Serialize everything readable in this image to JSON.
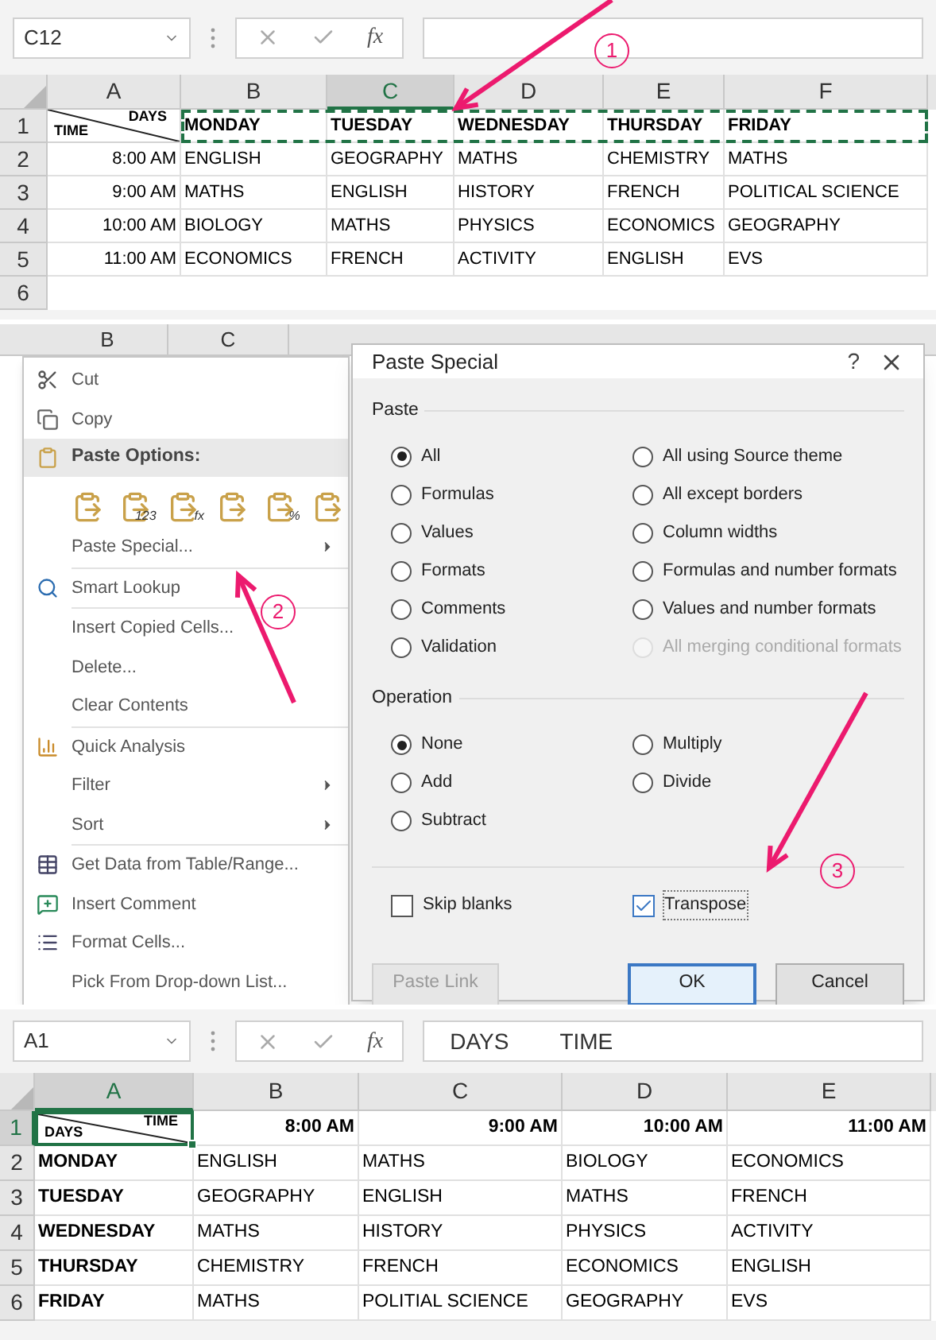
{
  "step1": {
    "name_box": "C12",
    "function_label": "fx",
    "callout": "1",
    "columns": [
      {
        "label": "A",
        "selected": false
      },
      {
        "label": "B",
        "selected": false
      },
      {
        "label": "C",
        "selected": true
      },
      {
        "label": "D",
        "selected": false
      },
      {
        "label": "E",
        "selected": false
      },
      {
        "label": "F",
        "selected": false
      }
    ],
    "rows": [
      {
        "number": "1",
        "selected": false,
        "marquee": true,
        "corner": {
          "top": "DAYS",
          "bottom": "TIME",
          "selected": false
        },
        "cells": [
          "MONDAY",
          "TUESDAY",
          "WEDNESDAY",
          "THURSDAY",
          "FRIDAY"
        ]
      },
      {
        "number": "2",
        "selected": false,
        "cells": [
          "8:00 AM",
          "ENGLISH",
          "GEOGRAPHY",
          "MATHS",
          "CHEMISTRY",
          "MATHS"
        ]
      },
      {
        "number": "3",
        "selected": false,
        "cells": [
          "9:00 AM",
          "MATHS",
          "ENGLISH",
          "HISTORY",
          "FRENCH",
          "POLITICAL SCIENCE"
        ]
      },
      {
        "number": "4",
        "selected": false,
        "cells": [
          "10:00 AM",
          "BIOLOGY",
          "MATHS",
          "PHYSICS",
          "ECONOMICS",
          "GEOGRAPHY"
        ]
      },
      {
        "number": "5",
        "selected": false,
        "cells": [
          "11:00 AM",
          "ECONOMICS",
          "FRENCH",
          "ACTIVITY",
          "ENGLISH",
          "EVS"
        ]
      },
      {
        "number": "6",
        "selected": false
      }
    ]
  },
  "step2": {
    "background_columns": [
      "B",
      "C"
    ],
    "menu": {
      "items": [
        {
          "kind": "item",
          "label": "Cut"
        },
        {
          "kind": "item",
          "label": "Copy"
        },
        {
          "kind": "header",
          "label": "Paste Options:"
        },
        {
          "kind": "paste_icons",
          "icons": [
            {
              "kind": "plain"
            },
            {
              "kind": "labeled",
              "label": "123"
            },
            {
              "kind": "labeled",
              "label": "fx"
            },
            {
              "kind": "plain"
            },
            {
              "kind": "labeled",
              "label": "%"
            },
            {
              "kind": "plain"
            }
          ]
        },
        {
          "kind": "submenu",
          "label": "Paste Special..."
        },
        {
          "kind": "separator"
        },
        {
          "kind": "item",
          "label": "Smart Lookup"
        },
        {
          "kind": "separator"
        },
        {
          "kind": "item",
          "label": "Insert Copied Cells..."
        },
        {
          "kind": "item",
          "label": "Delete..."
        },
        {
          "kind": "item",
          "label": "Clear Contents"
        },
        {
          "kind": "separator"
        },
        {
          "kind": "item",
          "label": "Quick Analysis"
        },
        {
          "kind": "submenu",
          "label": "Filter"
        },
        {
          "kind": "submenu",
          "label": "Sort"
        },
        {
          "kind": "separator"
        },
        {
          "kind": "item",
          "label": "Get Data from Table/Range..."
        },
        {
          "kind": "item",
          "label": "Insert Comment"
        },
        {
          "kind": "item",
          "label": "Format Cells..."
        },
        {
          "kind": "item",
          "label": "Pick From Drop-down List..."
        }
      ]
    },
    "dialog": {
      "title": "Paste Special",
      "help": "?",
      "paste_label": "Paste",
      "paste_left": [
        {
          "label": "All",
          "selected": true,
          "disabled": false
        },
        {
          "label": "Formulas",
          "selected": false,
          "disabled": false
        },
        {
          "label": "Values",
          "selected": false,
          "disabled": false
        },
        {
          "label": "Formats",
          "selected": false,
          "disabled": false
        },
        {
          "label": "Comments",
          "selected": false,
          "disabled": false
        },
        {
          "label": "Validation",
          "selected": false,
          "disabled": false
        }
      ],
      "paste_right": [
        {
          "label": "All using Source theme",
          "selected": false,
          "disabled": false
        },
        {
          "label": "All except borders",
          "selected": false,
          "disabled": false
        },
        {
          "label": "Column widths",
          "selected": false,
          "disabled": false
        },
        {
          "label": "Formulas and number formats",
          "selected": false,
          "disabled": false
        },
        {
          "label": "Values and number formats",
          "selected": false,
          "disabled": false
        },
        {
          "label": "All merging conditional formats",
          "selected": false,
          "disabled": true
        }
      ],
      "operation_label": "Operation",
      "operation_left": [
        {
          "label": "None",
          "selected": true,
          "disabled": false
        },
        {
          "label": "Add",
          "selected": false,
          "disabled": false
        },
        {
          "label": "Subtract",
          "selected": false,
          "disabled": false
        }
      ],
      "operation_right": [
        {
          "label": "Multiply",
          "selected": false,
          "disabled": false
        },
        {
          "label": "Divide",
          "selected": false,
          "disabled": false
        }
      ],
      "checkboxes": [
        {
          "label": "Skip blanks",
          "checked": false
        },
        {
          "label": "Transpose",
          "checked": true
        }
      ],
      "buttons": [
        {
          "label": "Paste Link",
          "disabled": true,
          "default": false
        },
        {
          "label": "OK",
          "disabled": false,
          "default": true
        },
        {
          "label": "Cancel",
          "disabled": false,
          "default": false
        }
      ]
    },
    "callouts": [
      "2",
      "3"
    ]
  },
  "step3": {
    "name_box": "A1",
    "function_label": "fx",
    "formula": [
      "DAYS",
      "TIME"
    ],
    "columns": [
      {
        "label": "A",
        "selected": true
      },
      {
        "label": "B",
        "selected": false
      },
      {
        "label": "C",
        "selected": false
      },
      {
        "label": "D",
        "selected": false
      },
      {
        "label": "E",
        "selected": false
      }
    ],
    "rows": [
      {
        "number": "1",
        "selected": true,
        "corner": {
          "top": "TIME",
          "bottom": "DAYS",
          "selected": true
        },
        "cells": [
          "8:00 AM",
          "9:00 AM",
          "10:00 AM",
          "11:00 AM"
        ]
      },
      {
        "number": "2",
        "selected": false,
        "cells": [
          "MONDAY",
          "ENGLISH",
          "MATHS",
          "BIOLOGY",
          "ECONOMICS"
        ]
      },
      {
        "number": "3",
        "selected": false,
        "cells": [
          "TUESDAY",
          "GEOGRAPHY",
          "ENGLISH",
          "MATHS",
          "FRENCH"
        ]
      },
      {
        "number": "4",
        "selected": false,
        "cells": [
          "WEDNESDAY",
          "MATHS",
          "HISTORY",
          "PHYSICS",
          "ACTIVITY"
        ]
      },
      {
        "number": "5",
        "selected": false,
        "cells": [
          "THURSDAY",
          "CHEMISTRY",
          "FRENCH",
          "ECONOMICS",
          "ENGLISH"
        ]
      },
      {
        "number": "6",
        "selected": false,
        "cells": [
          "FRIDAY",
          "MATHS",
          "POLITIAL SCIENCE",
          "GEOGRAPHY",
          "EVS"
        ]
      }
    ]
  }
}
